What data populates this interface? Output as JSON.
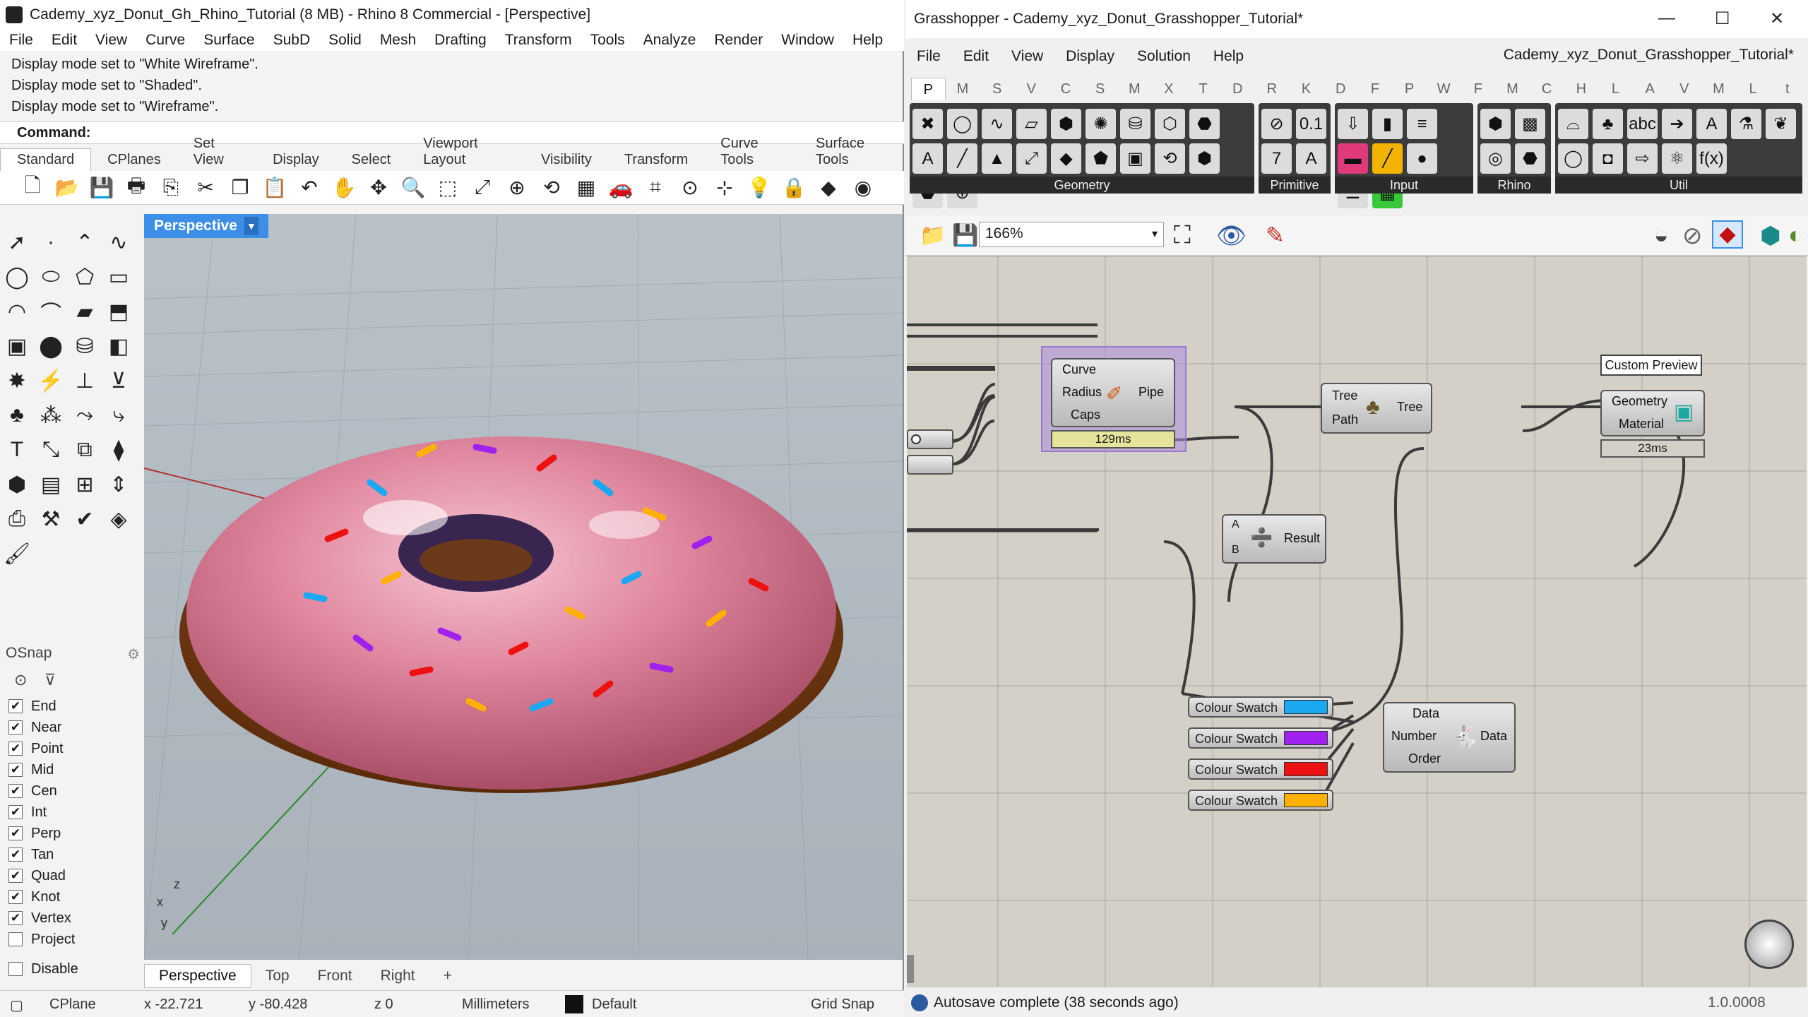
{
  "rhino": {
    "title": "Cademy_xyz_Donut_Gh_Rhino_Tutorial (8 MB) - Rhino 8 Commercial - [Perspective]",
    "menu": [
      "File",
      "Edit",
      "View",
      "Curve",
      "Surface",
      "SubD",
      "Solid",
      "Mesh",
      "Drafting",
      "Transform",
      "Tools",
      "Analyze",
      "Render",
      "Window",
      "Help"
    ],
    "history": [
      "Display mode set to \"White Wireframe\".",
      "Display mode set to \"Shaded\".",
      "Display mode set to \"Wireframe\"."
    ],
    "command_label": "Command:",
    "toolbar_tabs": [
      "Standard",
      "CPlanes",
      "Set View",
      "Display",
      "Select",
      "Viewport Layout",
      "Visibility",
      "Transform",
      "Curve Tools",
      "Surface Tools"
    ],
    "viewport_title": "Perspective",
    "osnap": {
      "title": "OSnap",
      "items": [
        {
          "label": "End",
          "checked": true
        },
        {
          "label": "Near",
          "checked": true
        },
        {
          "label": "Point",
          "checked": true
        },
        {
          "label": "Mid",
          "checked": true
        },
        {
          "label": "Cen",
          "checked": true
        },
        {
          "label": "Int",
          "checked": true
        },
        {
          "label": "Perp",
          "checked": true
        },
        {
          "label": "Tan",
          "checked": true
        },
        {
          "label": "Quad",
          "checked": true
        },
        {
          "label": "Knot",
          "checked": true
        },
        {
          "label": "Vertex",
          "checked": true
        },
        {
          "label": "Project",
          "checked": false
        }
      ],
      "disable_label": "Disable"
    },
    "viewport_tabs": [
      "Perspective",
      "Top",
      "Front",
      "Right"
    ],
    "status": {
      "cplane": "CPlane",
      "x": "x -22.721",
      "y": "y -80.428",
      "z": "z 0",
      "units": "Millimeters",
      "layer": "Default",
      "gridsnap": "Grid Snap"
    }
  },
  "grasshopper": {
    "title": "Grasshopper - Cademy_xyz_Donut_Grasshopper_Tutorial*",
    "menu": [
      "File",
      "Edit",
      "View",
      "Display",
      "Solution",
      "Help"
    ],
    "doc_name": "Cademy_xyz_Donut_Grasshopper_Tutorial*",
    "category_tabs": [
      "P",
      "M",
      "S",
      "V",
      "C",
      "S",
      "M",
      "X",
      "T",
      "D",
      "R",
      "K",
      "D",
      "F",
      "P",
      "W",
      "F",
      "M",
      "C",
      "H",
      "L",
      "A",
      "V",
      "M",
      "L",
      "t"
    ],
    "panel_groups": [
      "Geometry",
      "Primitive",
      "Input",
      "Rhino",
      "Util"
    ],
    "zoom": "166%",
    "components": {
      "pipe": {
        "inputs": [
          "Curve",
          "Radius",
          "Caps"
        ],
        "output": "Pipe",
        "time": "129ms"
      },
      "tree": {
        "inputs": [
          "Tree",
          "Path"
        ],
        "output": "Tree"
      },
      "preview": {
        "title": "Custom Preview",
        "inputs": [
          "Geometry",
          "Material"
        ],
        "time": "23ms"
      },
      "division": {
        "inputs": [
          "A",
          "B"
        ],
        "output": "Result"
      },
      "random": {
        "inputs": [
          "Data",
          "Number",
          "Order"
        ],
        "output": "Data"
      },
      "swatches": [
        {
          "label": "Colour Swatch",
          "color": "#1aa8f0"
        },
        {
          "label": "Colour Swatch",
          "color": "#a020f0"
        },
        {
          "label": "Colour Swatch",
          "color": "#ee1111"
        },
        {
          "label": "Colour Swatch",
          "color": "#ffb000"
        }
      ]
    },
    "status": "Autosave complete (38 seconds ago)",
    "version": "1.0.0008"
  }
}
